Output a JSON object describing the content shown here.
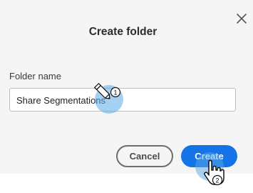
{
  "dialog": {
    "title": "Create folder",
    "close_icon": "close-icon",
    "field_label": "Folder name",
    "input_value": "Share Segmentations",
    "cancel_label": "Cancel",
    "create_label": "Create"
  },
  "annotations": {
    "step1_label": "1",
    "step2_label": "2",
    "step1_icon": "pencil-cursor-icon",
    "step2_icon": "hand-pointer-icon"
  },
  "colors": {
    "accent": "#1473e6",
    "highlight": "#5aa9e6",
    "dialog_bg": "#f5f5f5"
  }
}
